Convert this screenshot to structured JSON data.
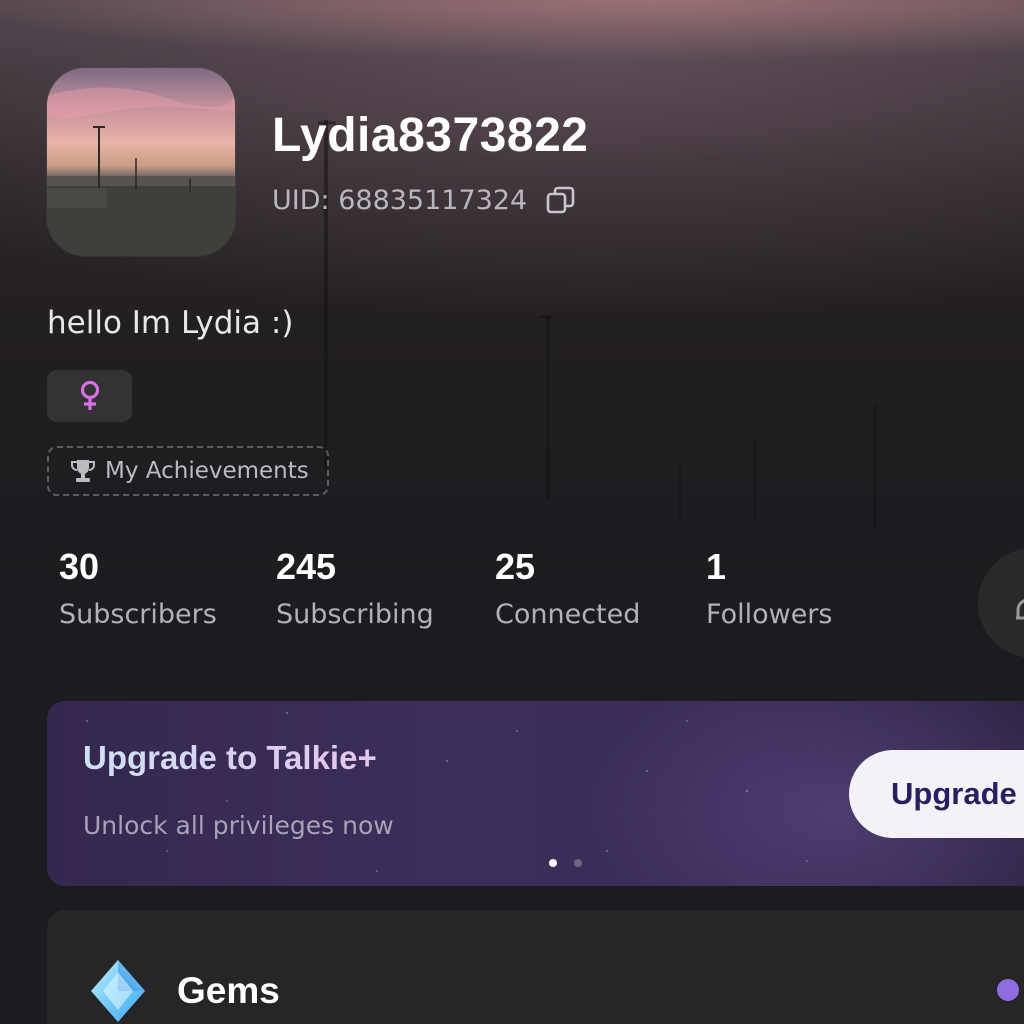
{
  "profile": {
    "username": "Lydia8373822",
    "uid_label": "UID:",
    "uid_value": "68835117324",
    "bio": "hello Im Lydia :)",
    "gender_icon": "female-symbol-icon",
    "achievements_label": "My Achievements"
  },
  "stats": [
    {
      "value": "30",
      "label": "Subscribers"
    },
    {
      "value": "245",
      "label": "Subscribing"
    },
    {
      "value": "25",
      "label": "Connected"
    },
    {
      "value": "1",
      "label": "Followers"
    }
  ],
  "upgrade": {
    "title": "Upgrade to Talkie+",
    "subtitle": "Unlock all privileges now",
    "button_label": "Upgrade",
    "carousel_pages": 2,
    "carousel_active": 1
  },
  "gems": {
    "label": "Gems"
  },
  "colors": {
    "background": "#1c1b1f",
    "card": "#262528",
    "upgrade_card": "#3c2e5b",
    "upgrade_button_text": "#2a1f5e",
    "female_icon": "#d870e6",
    "accent_dot": "#8f6ce0"
  }
}
